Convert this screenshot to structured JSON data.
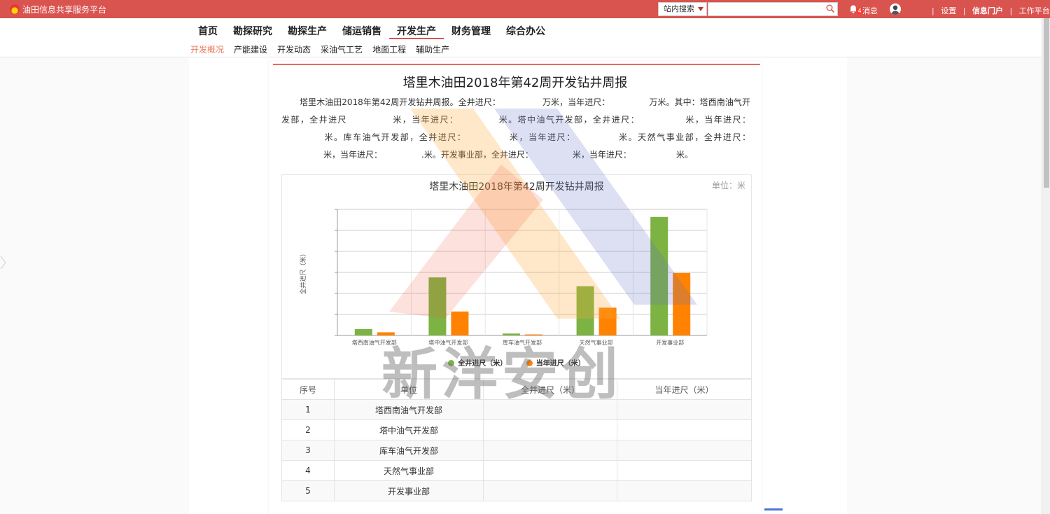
{
  "topbar": {
    "brand": "油田信息共享服务平台",
    "search_scope": "站内搜索",
    "search_placeholder": "",
    "badge_count": "4",
    "message_label": "消息",
    "links": [
      "设置",
      "信息门户",
      "工作平台"
    ],
    "colors": {
      "bar": "#d9534f"
    }
  },
  "nav": {
    "main": [
      "首页",
      "勘探研究",
      "勘探生产",
      "储运销售",
      "开发生产",
      "财务管理",
      "综合办公"
    ],
    "active_main": "开发生产",
    "sub": [
      "开发概况",
      "产能建设",
      "开发动态",
      "采油气工艺",
      "地面工程",
      "辅助生产"
    ],
    "active_sub": "开发概况"
  },
  "article": {
    "title": "塔里木油田2018年第42周开发钻井周报",
    "paragraph": {
      "p1": "塔里木油田2018年第42周开发钻井周报。全井进尺：",
      "p2": "万米，当年进尺：",
      "p3": "万米。其中：塔西南油气开发部，全井进尺",
      "p4": "米，当年进尺：",
      "p5": "米。塔中油气开发部，全井进尺：",
      "p6": "米，当年进尺：",
      "p7": "米。库车油气开发部，全井进尺：",
      "p8": "米，当年进尺：",
      "p9": "米。天然气事业部，全井进尺：",
      "p10": "米，当年进尺：",
      "p11": ".米。开发事业部，全井进尺：",
      "p12": "米，当年进尺：",
      "p13": "米。"
    }
  },
  "chart_data": {
    "type": "bar",
    "title": "塔里木油田2018年第42周开发钻井周报",
    "unit_label": "单位：米",
    "ylabel": "全井进尺（米）",
    "categories": [
      "塔西南油气开发部",
      "塔中油气开发部",
      "库车油气开发部",
      "天然气事业部",
      "开发事业部"
    ],
    "series": [
      {
        "name": "全井进尺（米）",
        "color": "#7cb342",
        "values": [
          5,
          46,
          1.5,
          39,
          94
        ]
      },
      {
        "name": "当年进尺（米）",
        "color": "#ff8300",
        "values": [
          2.5,
          19,
          0.8,
          22,
          49.5
        ]
      }
    ],
    "ylim": [
      0,
      100
    ],
    "grid": true,
    "legend_position": "bottom"
  },
  "table": {
    "headers": [
      "序号",
      "单位",
      "全井进尺（米）",
      "当年进尺（米）"
    ],
    "rows": [
      {
        "no": "1",
        "unit": "塔西南油气开发部"
      },
      {
        "no": "2",
        "unit": "塔中油气开发部"
      },
      {
        "no": "3",
        "unit": "库车油气开发部"
      },
      {
        "no": "4",
        "unit": "天然气事业部"
      },
      {
        "no": "5",
        "unit": "开发事业部"
      }
    ]
  },
  "watermark": {
    "text": "新洋安创"
  }
}
